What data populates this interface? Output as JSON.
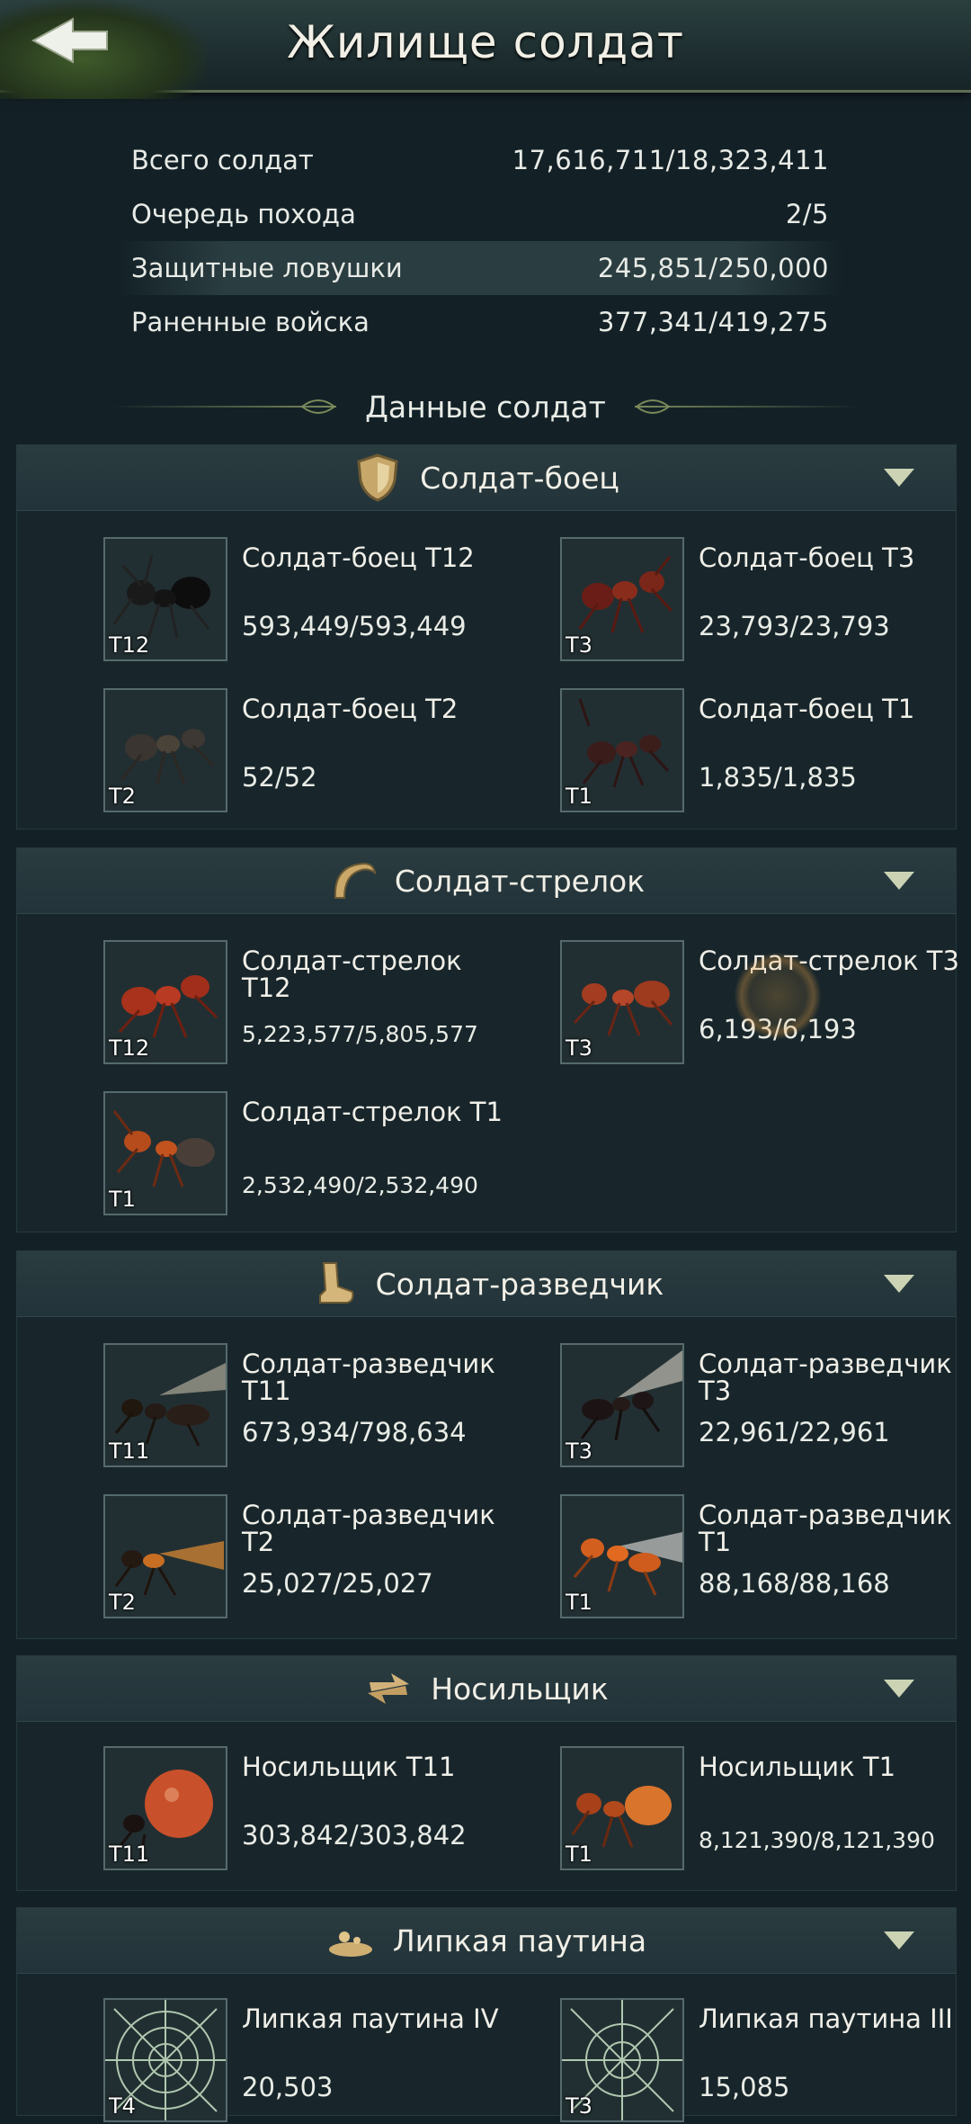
{
  "header": {
    "title": "Жилище солдат"
  },
  "summary": [
    {
      "label": "Всего солдат",
      "value": "17,616,711/18,323,411"
    },
    {
      "label": "Очередь похода",
      "value": "2/5"
    },
    {
      "label": "Защитные ловушки",
      "value": "245,851/250,000"
    },
    {
      "label": "Раненные войска",
      "value": "377,341/419,275"
    }
  ],
  "data_title": "Данные солдат",
  "categories": [
    {
      "name": "Солдат-боец",
      "icon": "shield-icon",
      "units": [
        {
          "name": "Солдат-боец T12",
          "tier": "T12",
          "count": "593,449/593,449"
        },
        {
          "name": "Солдат-боец T3",
          "tier": "T3",
          "count": "23,793/23,793"
        },
        {
          "name": "Солдат-боец T2",
          "tier": "T2",
          "count": "52/52"
        },
        {
          "name": "Солдат-боец T1",
          "tier": "T1",
          "count": "1,835/1,835"
        }
      ]
    },
    {
      "name": "Солдат-стрелок",
      "icon": "bow-icon",
      "units": [
        {
          "name": "Солдат-стрелок T12",
          "tier": "T12",
          "count": "5,223,577/5,805,577"
        },
        {
          "name": "Солдат-стрелок T3",
          "tier": "T3",
          "count": "6,193/6,193"
        },
        {
          "name": "Солдат-стрелок T1",
          "tier": "T1",
          "count": "2,532,490/2,532,490"
        }
      ]
    },
    {
      "name": "Солдат-разведчик",
      "icon": "boot-icon",
      "units": [
        {
          "name": "Солдат-разведчик T11",
          "tier": "T11",
          "count": "673,934/798,634"
        },
        {
          "name": "Солдат-разведчик T3",
          "tier": "T3",
          "count": "22,961/22,961"
        },
        {
          "name": "Солдат-разведчик T2",
          "tier": "T2",
          "count": "25,027/25,027"
        },
        {
          "name": "Солдат-разведчик T1",
          "tier": "T1",
          "count": "88,168/88,168"
        }
      ]
    },
    {
      "name": "Носильщик",
      "icon": "transfer-arrows-icon",
      "units": [
        {
          "name": "Носильщик T11",
          "tier": "T11",
          "count": "303,842/303,842"
        },
        {
          "name": "Носильщик T1",
          "tier": "T1",
          "count": "8,121,390/8,121,390"
        }
      ]
    },
    {
      "name": "Липкая паутина",
      "icon": "web-trap-icon",
      "units": [
        {
          "name": "Липкая паутина IV",
          "tier": "T4",
          "count": "20,503"
        },
        {
          "name": "Липкая паутина III",
          "tier": "T3",
          "count": "15,085"
        }
      ]
    }
  ]
}
